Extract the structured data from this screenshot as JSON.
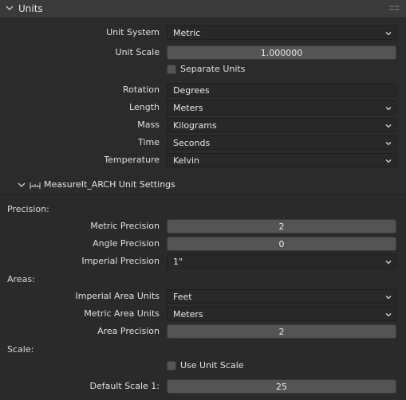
{
  "units_panel": {
    "title": "Units",
    "unit_system": {
      "label": "Unit System",
      "value": "Metric"
    },
    "unit_scale": {
      "label": "Unit Scale",
      "value": "1.000000"
    },
    "separate_units": {
      "label": "Separate Units",
      "checked": false
    },
    "rotation": {
      "label": "Rotation",
      "value": "Degrees"
    },
    "length": {
      "label": "Length",
      "value": "Meters"
    },
    "mass": {
      "label": "Mass",
      "value": "Kilograms"
    },
    "time": {
      "label": "Time",
      "value": "Seconds"
    },
    "temperature": {
      "label": "Temperature",
      "value": "Kelvin"
    }
  },
  "measureit": {
    "title": "MeasureIt_ARCH Unit Settings",
    "precision_section": "Precision:",
    "metric_precision": {
      "label": "Metric Precision",
      "value": "2"
    },
    "angle_precision": {
      "label": "Angle Precision",
      "value": "0"
    },
    "imperial_precision": {
      "label": "Imperial Precision",
      "value": "1\""
    },
    "areas_section": "Areas:",
    "imperial_area_units": {
      "label": "Imperial Area Units",
      "value": "Feet"
    },
    "metric_area_units": {
      "label": "Metric Area Units",
      "value": "Meters"
    },
    "area_precision": {
      "label": "Area Precision",
      "value": "2"
    },
    "scale_section": "Scale:",
    "use_unit_scale": {
      "label": "Use Unit Scale",
      "checked": false
    },
    "default_scale": {
      "label": "Default Scale 1:",
      "value": "25"
    }
  }
}
